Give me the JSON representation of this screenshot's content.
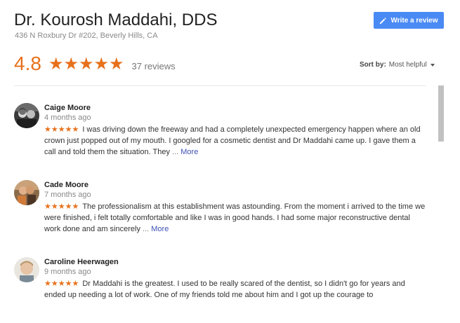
{
  "business": {
    "name": "Dr. Kourosh Maddahi, DDS",
    "address": "436 N Roxbury Dr #202, Beverly Hills, CA"
  },
  "write_review_label": "Write a review",
  "rating": {
    "score": "4.8",
    "stars": "★★★★★",
    "count_text": "37 reviews"
  },
  "sort": {
    "label": "Sort by:",
    "value": "Most helpful"
  },
  "colors": {
    "accent_orange": "#e7711b",
    "button_blue": "#4a8af4",
    "link_blue": "#3f51b5"
  },
  "reviews": [
    {
      "name": "Caige Moore",
      "date": "4 months ago",
      "stars": "★★★★★",
      "text": "I was driving down the freeway and had a completely unexpected emergency happen where an old crown just popped out of my mouth. I googled for a cosmetic dentist and Dr Maddahi came up. I gave them a call and told them the situation. They",
      "ellipsis": "...",
      "more": "More"
    },
    {
      "name": "Cade Moore",
      "date": "7 months ago",
      "stars": "★★★★★",
      "text": "The professionalism at this establishment was astounding. From the moment i arrived to the time we were finished, i felt totally comfortable and like I was in good hands. I had some major reconstructive dental work done and am sincerely",
      "ellipsis": "...",
      "more": "More"
    },
    {
      "name": "Caroline Heerwagen",
      "date": "9 months ago",
      "stars": "★★★★★",
      "text": "Dr Maddahi is the greatest. I used to be really scared of the dentist, so I didn't go for years and ended up needing a lot of work. One of my friends told me about him and I got up the courage to",
      "ellipsis": "",
      "more": ""
    }
  ]
}
